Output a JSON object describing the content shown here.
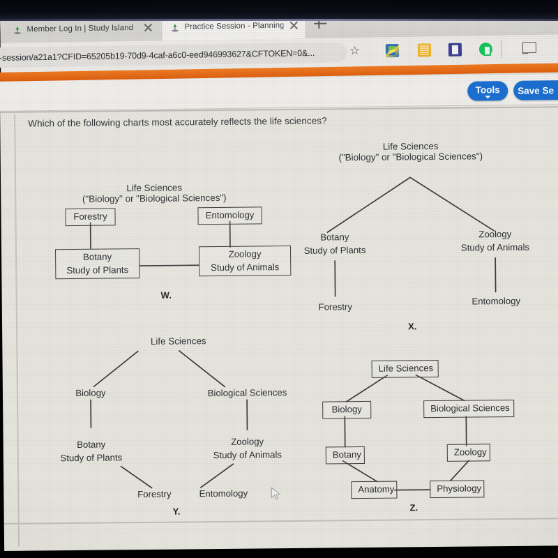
{
  "browser": {
    "tabs": [
      {
        "title": "Member Log In | Study Island",
        "active": false,
        "favicon": "study-island-icon"
      },
      {
        "title": "Practice Session - Planning and",
        "active": true,
        "favicon": "study-island-icon"
      }
    ],
    "new_tab_label": "+",
    "url": "-session/a21a1?CFID=65205b19-70d9-4caf-a6c0-eed946993627&CFTOKEN=0&...",
    "bookmark_icon": "star-icon",
    "extensions": [
      "extension-icon-1",
      "extension-icon-2",
      "extension-icon-3",
      "extension-icon-4"
    ],
    "cast_icon": "cast-icon",
    "minimize_icon": "minimize-icon"
  },
  "app_header": {
    "tools_label": "Tools",
    "save_label": "Save Se",
    "accent_color": "#1b6fd1",
    "band_color": "#e86f16"
  },
  "question": {
    "prompt": "Which of the following charts most accurately reflects the life sciences?"
  },
  "chart_data": [
    {
      "id": "W",
      "type": "diagram",
      "label": "W.",
      "title_lines": [
        "Life Sciences",
        "(\"Biology\" or \"Biological Sciences\")"
      ],
      "nodes": [
        {
          "key": "forestry",
          "lines": [
            "Forestry"
          ],
          "boxed": true
        },
        {
          "key": "entomology",
          "lines": [
            "Entomology"
          ],
          "boxed": true
        },
        {
          "key": "botany",
          "lines": [
            "Botany",
            "Study of Plants"
          ],
          "boxed": true
        },
        {
          "key": "zoology",
          "lines": [
            "Zoology",
            "Study of Animals"
          ],
          "boxed": true
        }
      ],
      "edges": [
        {
          "from": "forestry",
          "to": "botany"
        },
        {
          "from": "entomology",
          "to": "zoology"
        },
        {
          "from": "botany",
          "to": "zoology"
        }
      ]
    },
    {
      "id": "X",
      "type": "diagram",
      "label": "X.",
      "title_lines": [
        "Life Sciences",
        "(\"Biology\" or \"Biological Sciences\")"
      ],
      "nodes": [
        {
          "key": "botany",
          "lines": [
            "Botany",
            "Study of Plants"
          ],
          "boxed": false
        },
        {
          "key": "zoology",
          "lines": [
            "Zoology",
            "Study of Animals"
          ],
          "boxed": false
        },
        {
          "key": "forestry",
          "lines": [
            "Forestry"
          ],
          "boxed": false
        },
        {
          "key": "entomology",
          "lines": [
            "Entomology"
          ],
          "boxed": false
        }
      ],
      "edges": [
        {
          "from": "title",
          "to": "botany"
        },
        {
          "from": "title",
          "to": "zoology"
        },
        {
          "from": "botany",
          "to": "forestry"
        },
        {
          "from": "zoology",
          "to": "entomology"
        }
      ]
    },
    {
      "id": "Y",
      "type": "diagram",
      "label": "Y.",
      "title_lines": [
        "Life Sciences"
      ],
      "nodes": [
        {
          "key": "biology",
          "lines": [
            "Biology"
          ],
          "boxed": false
        },
        {
          "key": "bio_sci",
          "lines": [
            "Biological Sciences"
          ],
          "boxed": false
        },
        {
          "key": "botany",
          "lines": [
            "Botany",
            "Study of Plants"
          ],
          "boxed": false
        },
        {
          "key": "zoology",
          "lines": [
            "Zoology",
            "Study of Animals"
          ],
          "boxed": false
        },
        {
          "key": "forestry",
          "lines": [
            "Forestry"
          ],
          "boxed": false
        },
        {
          "key": "entomology",
          "lines": [
            "Entomology"
          ],
          "boxed": false
        }
      ],
      "edges": [
        {
          "from": "title",
          "to": "biology"
        },
        {
          "from": "title",
          "to": "bio_sci"
        },
        {
          "from": "biology",
          "to": "botany"
        },
        {
          "from": "bio_sci",
          "to": "zoology"
        },
        {
          "from": "botany",
          "to": "forestry"
        },
        {
          "from": "zoology",
          "to": "entomology"
        }
      ]
    },
    {
      "id": "Z",
      "type": "diagram",
      "label": "Z.",
      "title_lines": [
        "Life Sciences"
      ],
      "nodes": [
        {
          "key": "life_sci",
          "lines": [
            "Life Sciences"
          ],
          "boxed": true
        },
        {
          "key": "biology",
          "lines": [
            "Biology"
          ],
          "boxed": true
        },
        {
          "key": "bio_sci",
          "lines": [
            "Biological Sciences"
          ],
          "boxed": true
        },
        {
          "key": "botany",
          "lines": [
            "Botany"
          ],
          "boxed": true
        },
        {
          "key": "zoology",
          "lines": [
            "Zoology"
          ],
          "boxed": true
        },
        {
          "key": "anatomy",
          "lines": [
            "Anatomy"
          ],
          "boxed": true
        },
        {
          "key": "physiology",
          "lines": [
            "Physiology"
          ],
          "boxed": true
        }
      ],
      "edges": [
        {
          "from": "life_sci",
          "to": "biology"
        },
        {
          "from": "life_sci",
          "to": "bio_sci"
        },
        {
          "from": "biology",
          "to": "botany"
        },
        {
          "from": "bio_sci",
          "to": "zoology"
        },
        {
          "from": "botany",
          "to": "anatomy"
        },
        {
          "from": "zoology",
          "to": "physiology"
        },
        {
          "from": "anatomy",
          "to": "physiology"
        }
      ]
    }
  ],
  "charts": {
    "W": {
      "title_l1": "Life Sciences",
      "title_l2": "(\"Biology\" or \"Biological Sciences\")",
      "forestry": "Forestry",
      "entomology": "Entomology",
      "botany_l1": "Botany",
      "botany_l2": "Study of Plants",
      "zoology_l1": "Zoology",
      "zoology_l2": "Study of Animals",
      "label": "W."
    },
    "X": {
      "title_l1": "Life Sciences",
      "title_l2": "(\"Biology\" or \"Biological Sciences\")",
      "botany_l1": "Botany",
      "botany_l2": "Study of Plants",
      "zoology_l1": "Zoology",
      "zoology_l2": "Study of Animals",
      "forestry": "Forestry",
      "entomology": "Entomology",
      "label": "X."
    },
    "Y": {
      "title_l1": "Life Sciences",
      "biology": "Biology",
      "bio_sci": "Biological Sciences",
      "botany_l1": "Botany",
      "botany_l2": "Study of Plants",
      "zoology_l1": "Zoology",
      "zoology_l2": "Study of Animals",
      "forestry": "Forestry",
      "entomology": "Entomology",
      "label": "Y."
    },
    "Z": {
      "life_sci": "Life Sciences",
      "biology": "Biology",
      "bio_sci": "Biological Sciences",
      "botany": "Botany",
      "zoology": "Zoology",
      "anatomy": "Anatomy",
      "physiology": "Physiology",
      "label": "Z."
    }
  },
  "cursor": {
    "icon": "mouse-pointer-icon"
  }
}
